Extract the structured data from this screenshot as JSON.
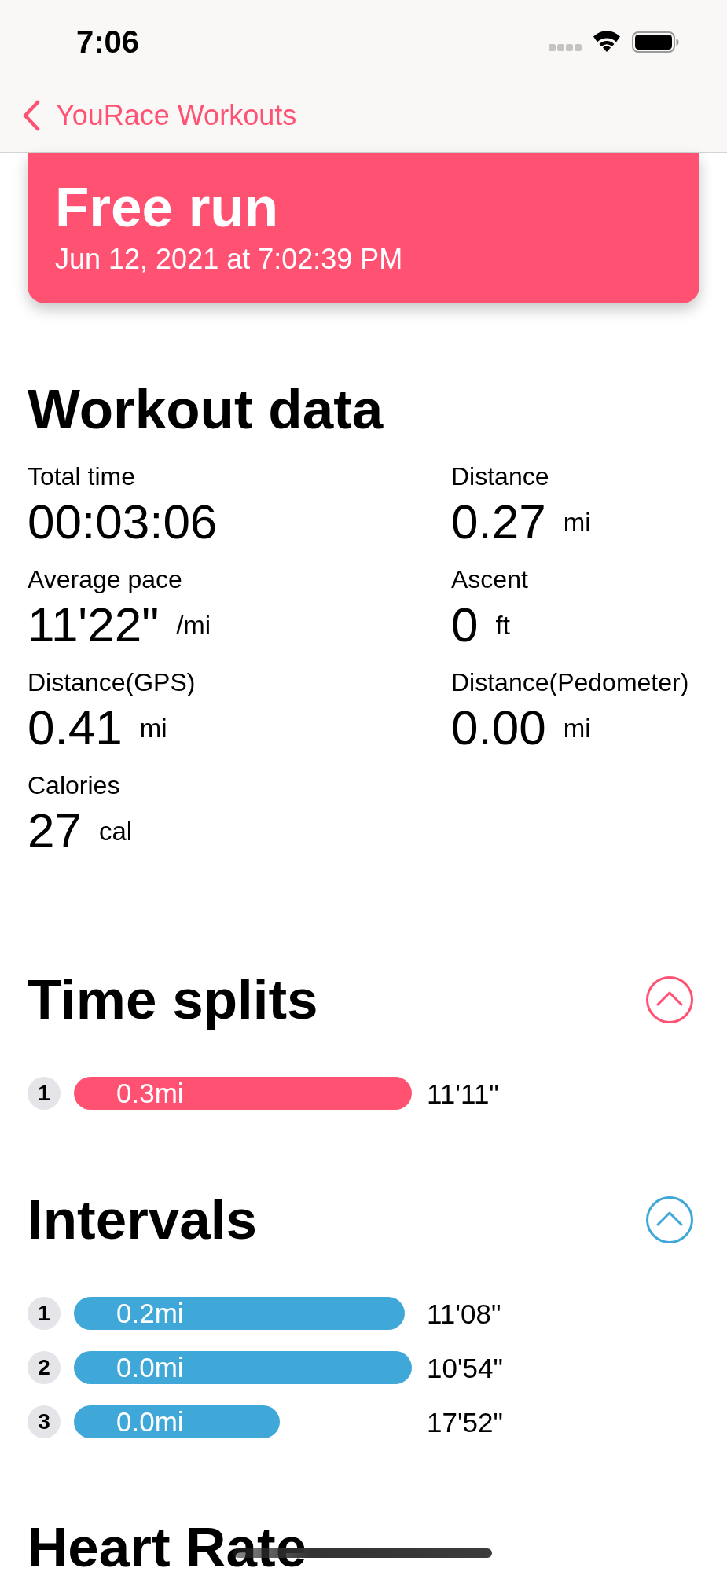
{
  "status_bar": {
    "time": "7:06"
  },
  "nav": {
    "back_label": "YouRace Workouts"
  },
  "header": {
    "title": "Free run",
    "date": "Jun 12, 2021 at 7:02:39 PM"
  },
  "workout_data": {
    "title": "Workout data",
    "stats": [
      {
        "label": "Total time",
        "value": "00:03:06"
      },
      {
        "label": "Distance",
        "value": "0.27",
        "unit": "mi"
      },
      {
        "label": "Average pace",
        "value": "11'22\"",
        "unit": "/mi"
      },
      {
        "label": "Ascent",
        "value": "0",
        "unit": "ft"
      },
      {
        "label": "Distance(GPS)",
        "value": "0.41",
        "unit": "mi"
      },
      {
        "label": "Distance(Pedometer)",
        "value": "0.00",
        "unit": "mi"
      },
      {
        "label": "Calories",
        "value": "27",
        "unit": "cal"
      }
    ]
  },
  "sections": [
    {
      "title": "Time splits",
      "color": "#ff5273",
      "expanded": true,
      "rows": [
        {
          "index": "1",
          "distance": "0.3mi",
          "time": "11'11\""
        }
      ]
    },
    {
      "title": "Intervals",
      "color": "#40a8d8",
      "expanded": true,
      "rows": [
        {
          "index": "1",
          "distance": "0.2mi",
          "time": "11'08\""
        },
        {
          "index": "2",
          "distance": "0.0mi",
          "time": "10'54\""
        },
        {
          "index": "3",
          "distance": "0.0mi",
          "time": "17'52\""
        }
      ]
    }
  ],
  "next_section": {
    "title": "Heart Rate"
  }
}
